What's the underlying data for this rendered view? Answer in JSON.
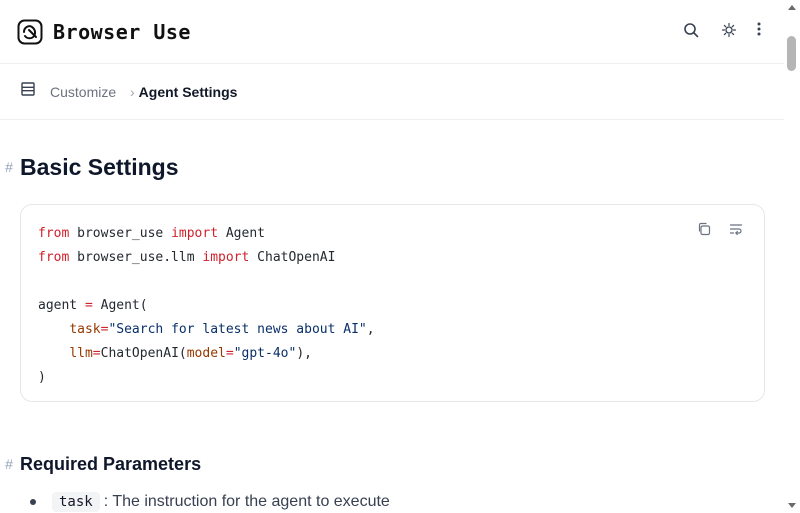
{
  "header": {
    "logo_text": "Browser Use",
    "search_icon": "search-icon",
    "theme_icon": "theme-toggle-icon",
    "more_icon": "more-vertical-icon"
  },
  "breadcrumb": {
    "menu_icon": "menu-icon",
    "items": [
      {
        "label": "Customize"
      },
      {
        "label": "Agent Settings"
      }
    ],
    "separator": "›"
  },
  "content": {
    "anchor_symbol": "#",
    "title": "Basic Settings",
    "code": {
      "copy_icon": "copy-icon",
      "wrap_icon": "wrap-icon"
    },
    "section_title": "Required Parameters",
    "params": [
      {
        "name": "task",
        "description": ": The instruction for the agent to execute"
      }
    ]
  },
  "colors": {
    "keyword": "#cf222e",
    "string": "#0a3069",
    "attribute": "#953800",
    "text": "#0f172a"
  }
}
